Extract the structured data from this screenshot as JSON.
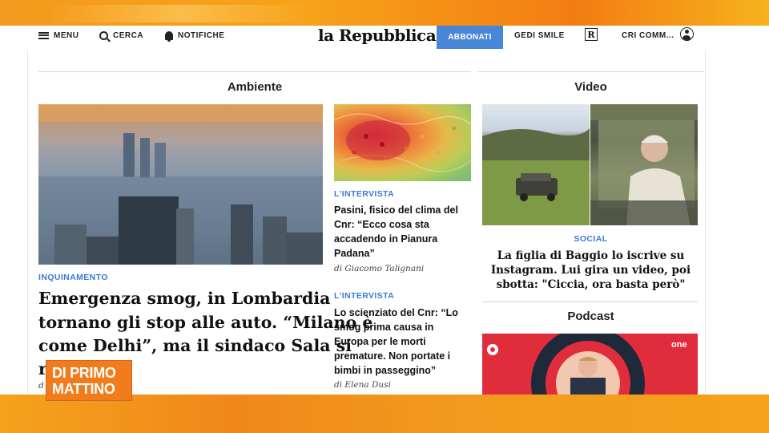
{
  "nav": {
    "menu_label": "MENU",
    "search_label": "CERCA",
    "notifications_label": "NOTIFICHE",
    "logo": "la Repubblica",
    "subscribe_label": "ABBONATI",
    "gedi_label": "GEDI SMILE",
    "r_icon_letter": "R",
    "account_label": "CRI COMM..."
  },
  "sections": {
    "ambiente": "Ambiente",
    "video": "Video",
    "podcast": "Podcast"
  },
  "main_story": {
    "kicker": "INQUINAMENTO",
    "headline_line1": "Emergenza smog, in Lombardia",
    "headline_line2": "tornano gli stop alle auto. “Milano è",
    "headline_line3": "come Delhi”, ma il sindaco Sala si",
    "headline_line4_partial": "r",
    "byline_partial": "d"
  },
  "side_story_1": {
    "kicker": "L'INTERVISTA",
    "headline_lines": [
      "Pasini, fisico del clima del",
      "Cnr: “Ecco cosa sta",
      "accadendo in Pianura",
      "Padana”"
    ],
    "byline": "di Giacomo Talignani"
  },
  "side_story_2": {
    "kicker": "L'INTERVISTA",
    "headline_lines": [
      "Lo scienziato del Cnr: “Lo",
      "smog prima causa in",
      "Europa per le morti",
      "premature. Non portate i",
      "bimbi in passeggino”"
    ],
    "byline": "di Elena Dusi"
  },
  "video_story": {
    "kicker": "SOCIAL",
    "headline_lines": [
      "La figlia di Baggio lo iscrive su",
      "Instagram. Lui gira un video, poi",
      "sbotta: \"Ciccia, ora basta però\""
    ]
  },
  "podcast_logo": "one",
  "tv_overlay": {
    "line1": "DI PRIMO",
    "line2": "MATTINO"
  },
  "colors": {
    "accent_blue": "#4a86d8",
    "kicker_blue": "#3a7bd5",
    "band_orange": "#f29a1d",
    "overlay_orange": "#f27c1c",
    "podcast_red": "#e02d3c"
  },
  "icons": [
    "menu-icon",
    "search-icon",
    "bell-icon",
    "user-icon"
  ]
}
